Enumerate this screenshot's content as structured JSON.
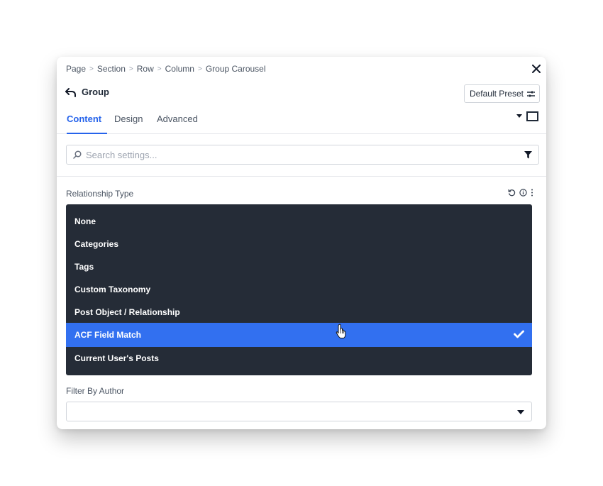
{
  "breadcrumb": [
    "Page",
    "Section",
    "Row",
    "Column",
    "Group Carousel"
  ],
  "header": {
    "title": "Group",
    "preset_label": "Default Preset"
  },
  "tabs": [
    {
      "label": "Content",
      "active": true
    },
    {
      "label": "Design",
      "active": false
    },
    {
      "label": "Advanced",
      "active": false
    }
  ],
  "search": {
    "placeholder": "Search settings..."
  },
  "relationship": {
    "label": "Relationship Type",
    "options": [
      {
        "label": "None",
        "selected": false
      },
      {
        "label": "Categories",
        "selected": false
      },
      {
        "label": "Tags",
        "selected": false
      },
      {
        "label": "Custom Taxonomy",
        "selected": false
      },
      {
        "label": "Post Object / Relationship",
        "selected": false
      },
      {
        "label": "ACF Field Match",
        "selected": true
      },
      {
        "label": "Current User's Posts",
        "selected": false
      }
    ]
  },
  "author": {
    "label": "Filter By Author",
    "value": ""
  },
  "colors": {
    "accent": "#2563eb",
    "dropdown_bg": "#252c37",
    "selected_bg": "#3270f0",
    "label": "#4b5563"
  },
  "icons": [
    "chevron-right-icon",
    "close-icon",
    "back-arrow-icon",
    "preset-settings-icon",
    "caret-down-icon",
    "square-icon",
    "search-icon",
    "filter-icon",
    "reset-icon",
    "info-icon",
    "more-vertical-icon",
    "checkmark-icon",
    "hand-cursor-icon"
  ]
}
